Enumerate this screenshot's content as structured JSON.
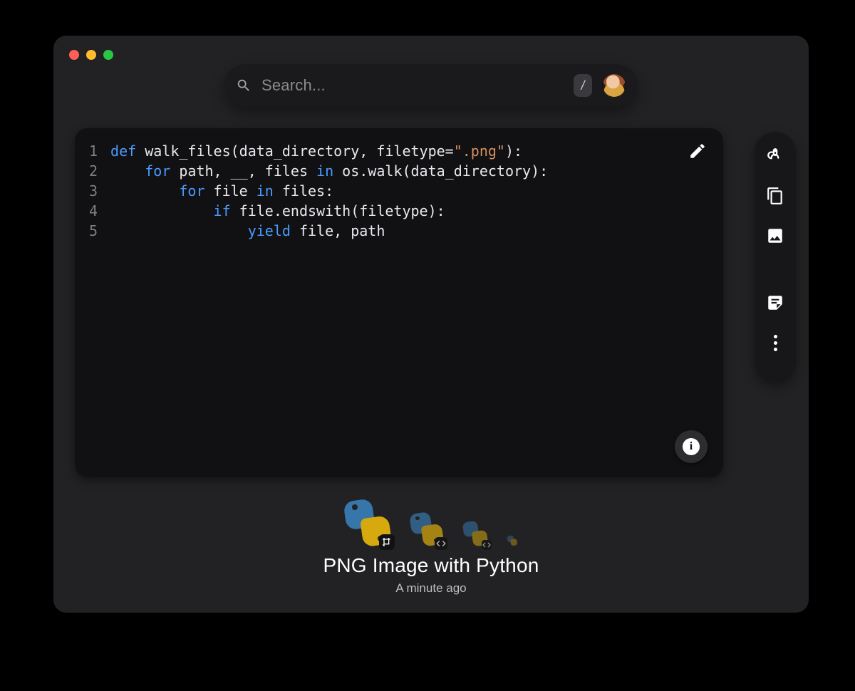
{
  "search": {
    "placeholder": "Search...",
    "slash_hint": "/"
  },
  "code": {
    "lines": [
      "1",
      "2",
      "3",
      "4",
      "5"
    ],
    "tokens": [
      [
        {
          "t": "def ",
          "c": "kw"
        },
        {
          "t": "walk_files(data_directory, filetype="
        },
        {
          "t": "\".png\"",
          "c": "str"
        },
        {
          "t": "):"
        }
      ],
      [
        {
          "t": "    "
        },
        {
          "t": "for ",
          "c": "kw"
        },
        {
          "t": "path, __, files "
        },
        {
          "t": "in ",
          "c": "kw"
        },
        {
          "t": "os.walk(data_directory):"
        }
      ],
      [
        {
          "t": "        "
        },
        {
          "t": "for ",
          "c": "kw"
        },
        {
          "t": "file "
        },
        {
          "t": "in ",
          "c": "kw"
        },
        {
          "t": "files:"
        }
      ],
      [
        {
          "t": "            "
        },
        {
          "t": "if ",
          "c": "kw"
        },
        {
          "t": "file.endswith(filetype):"
        }
      ],
      [
        {
          "t": "                "
        },
        {
          "t": "yield ",
          "c": "kw"
        },
        {
          "t": "file, path"
        }
      ]
    ]
  },
  "snippet": {
    "title": "PNG Image with Python",
    "timestamp": "A minute ago"
  },
  "rail": {
    "items": [
      "share-icon",
      "copy-icon",
      "image-icon",
      "note-icon",
      "more-icon"
    ]
  },
  "thumbnails": {
    "count": 4,
    "main_badge": "crop-icon",
    "secondary_badge": "code-icon",
    "tertiary_badge": "code-icon"
  }
}
